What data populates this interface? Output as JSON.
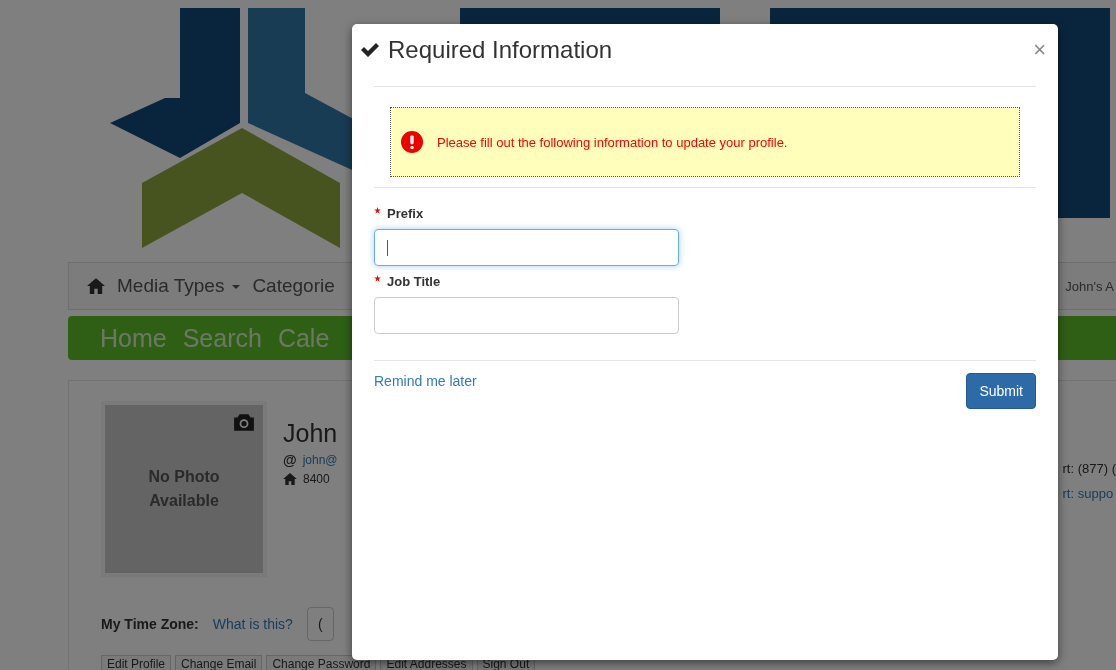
{
  "background": {
    "nav": {
      "items": [
        {
          "label": "Media Types",
          "dropdown": true
        },
        {
          "label": "Categorie",
          "dropdown": false
        }
      ],
      "right": "John's A"
    },
    "menu": [
      "Home",
      "Search",
      "Cale"
    ],
    "profile": {
      "photo_text": "No Photo Available",
      "name": "John",
      "at_sign": "@",
      "email": "john@",
      "address": "8400",
      "support_phone": "rt: (877) (",
      "support_email": "rt: suppo"
    },
    "time_zone": {
      "label": "My Time Zone:",
      "link": "What is this?",
      "select": "("
    },
    "buttons": [
      "Edit Profile",
      "Change Email",
      "Change Password",
      "Edit Addresses",
      "Sign Out"
    ]
  },
  "dialog": {
    "title": "Required Information",
    "close": "×",
    "alert": "Please fill out the following information to update your profile.",
    "fields": [
      {
        "label": "Prefix",
        "required": true,
        "focused": true
      },
      {
        "label": "Job Title",
        "required": true,
        "focused": false
      }
    ],
    "remind_link": "Remind me later",
    "submit": "Submit"
  }
}
